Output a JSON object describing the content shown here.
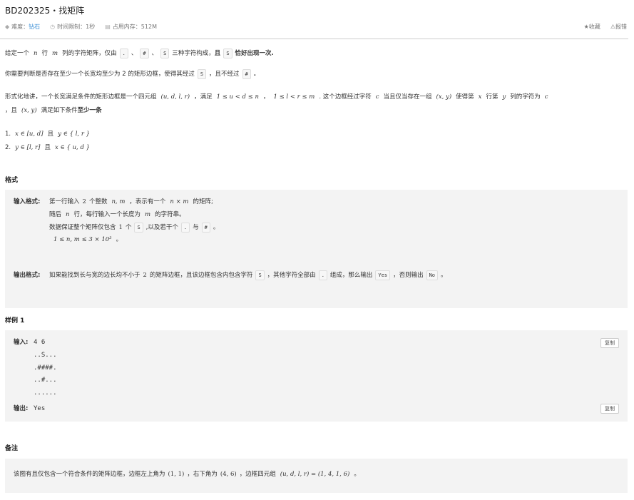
{
  "title": "BD202325・找矩阵",
  "meta": {
    "difficulty_label": "难度：",
    "difficulty_value": "钻石",
    "time_limit": "时间限制：1秒",
    "memory_limit": "占用内存：512M"
  },
  "actions": {
    "favorite": "收藏",
    "report": "报错"
  },
  "desc": {
    "l1a": "给定一个",
    "l1n": "n",
    "l1b": "行",
    "l1m": "m",
    "l1c": "列的字符矩阵，仅由",
    "l1d": "、",
    "l1e": "、",
    "l1f": "三种字符构成，",
    "l1g": "且",
    "l1h": "恰好出现一次.",
    "l2a": "你需要判断是否存在至少一个长宽均至少为 2 的矩形边框，使得其经过",
    "l2b": "，且不经过",
    "l2c": ".",
    "l3a": "形式化地讲，一个长宽满足条件的矩形边框是一个四元组",
    "l3b": "(u, d, l, r)",
    "l3c": "，满足",
    "l3d": "1 ≤ u < d ≤ n",
    "l3e": "，",
    "l3f": "1 ≤ l < r ≤ m",
    "l3g": ". 这个边框经过字符",
    "l3h": "c",
    "l3i": "当且仅当存在一组",
    "l3j": "(x, y)",
    "l3k": "使得第",
    "l3l": "x",
    "l3m": "行第",
    "l3n": "y",
    "l3o": "列的字符为",
    "l3p": "c",
    "l4a": "，且",
    "l4b": "(x, y)",
    "l4c": "满足如下条件",
    "l4d": "至少一条",
    "c1a": "1.",
    "c1b": "x ∈ [u, d]",
    "c1c": "且",
    "c1d": "y ∈ { l, r }",
    "c2a": "2.",
    "c2b": "y ∈ [l, r]",
    "c2c": "且",
    "c2d": "x ∈ { u, d }"
  },
  "chars": {
    "dot": ".",
    "hash": "#",
    "s": "S",
    "yes": "Yes",
    "no": "No"
  },
  "format": {
    "heading": "格式",
    "input_label": "输入格式:",
    "in1a": "第一行输入",
    "in1b": "2",
    "in1c": "个整数",
    "in1d": "n, m",
    "in1e": "，表示有一个",
    "in1f": "n × m",
    "in1g": "的矩阵;",
    "in2a": "随后",
    "in2b": "n",
    "in2c": "行，每行输入一个长度为",
    "in2d": "m",
    "in2e": "的字符串。",
    "in3a": "数据保证整个矩阵仅包含",
    "in3b": "1",
    "in3c": "个",
    "in3d": ",以及若干个",
    "in3e": "与",
    "in3f": "。",
    "in4a": "1 ≤ n, m ≤ 3 × 10³",
    "in4b": "。",
    "output_label": "输出格式:",
    "out1a": "如果能找到长与宽的边长均不小于",
    "out1b": "2",
    "out1c": "的矩阵边框，且该边框包含内包含字符",
    "out1d": "，其他字符全部由",
    "out1e": "组成，那么输出",
    "out1f": "，否则输出",
    "out1g": "。"
  },
  "sample": {
    "heading": "样例 1",
    "input_label": "输入:",
    "input_lines": [
      "4 6",
      "..S...",
      ".####.",
      "..#...",
      "......"
    ],
    "output_label": "输出:",
    "output_value": "Yes",
    "copy_label": "复制"
  },
  "note": {
    "heading": "备注",
    "n1a": "该图有且仅包含一个符合条件的矩阵边框，边框左上角为",
    "n1b": "(1, 1)",
    "n1c": "，右下角为",
    "n1d": "(4, 6)",
    "n1e": "，边框四元组",
    "n1f": "(u, d, l, r) = (1, 4, 1, 6)",
    "n1g": "。"
  }
}
